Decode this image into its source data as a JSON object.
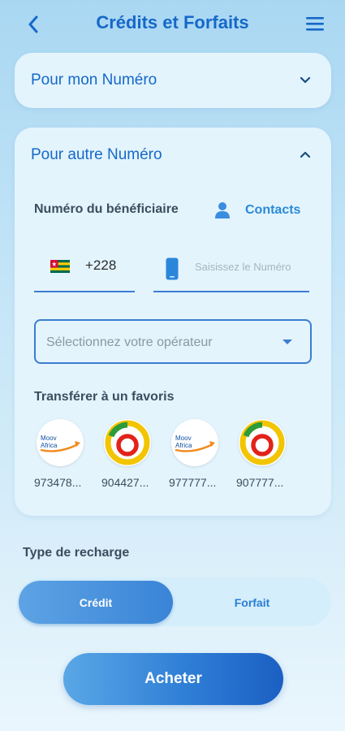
{
  "header": {
    "title": "Crédits et Forfaits"
  },
  "my_number": {
    "label": "Pour mon Numéro"
  },
  "other_number": {
    "label": "Pour autre Numéro",
    "beneficiary_label": "Numéro du bénéficiaire",
    "contacts_label": "Contacts",
    "dial_code": "+228",
    "phone_placeholder": "Saisissez le Numéro",
    "operator_placeholder": "Sélectionnez votre opérateur",
    "favorites_label": "Transférer à un favoris",
    "favorites": [
      {
        "number": "973478...",
        "operator_icon": "moov-africa-logo"
      },
      {
        "number": "904427...",
        "operator_icon": "togocom-logo"
      },
      {
        "number": "977777...",
        "operator_icon": "moov-africa-logo"
      },
      {
        "number": "907777...",
        "operator_icon": "togocom-logo"
      }
    ],
    "moov_logo_text": [
      "Moov",
      "Africa"
    ]
  },
  "recharge": {
    "type_label": "Type de recharge",
    "options": [
      "Crédit",
      "Forfait"
    ],
    "selected": "Crédit"
  },
  "buy_button": {
    "label": "Acheter"
  },
  "colors": {
    "primary": "#1668c9",
    "accent": "#3b7dd0",
    "card_bg": "#e3f4fd"
  }
}
